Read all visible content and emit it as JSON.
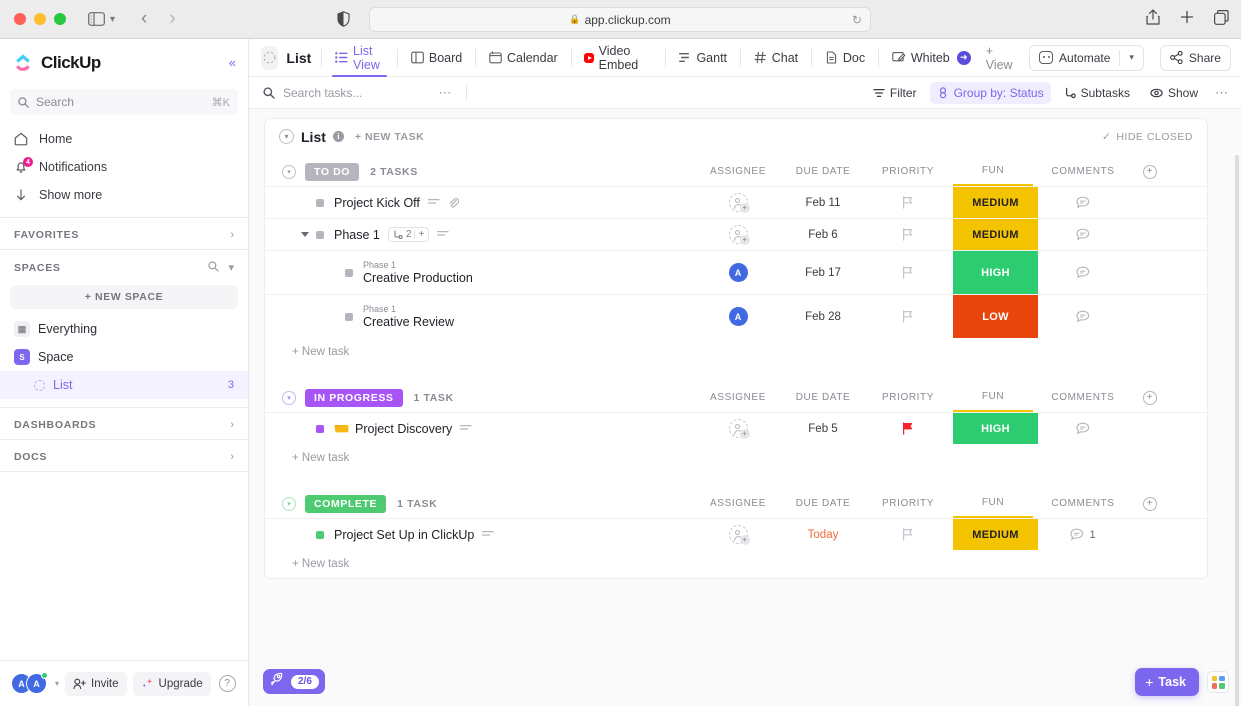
{
  "browser": {
    "url": "app.clickup.com",
    "lock_icon": "lock-icon",
    "reload_icon": "reload-icon",
    "back_icon": "back-arrow-icon",
    "forward_icon": "forward-arrow-icon",
    "sidebar_icon": "sidebar-toggle-icon",
    "share_icon": "share-icon",
    "new_tab_icon": "plus-icon",
    "tabs_icon": "tab-overview-icon"
  },
  "sidebar": {
    "brand": "ClickUp",
    "collapse_icon": "collapse-chevrons-icon",
    "search": {
      "placeholder": "Search",
      "shortcut": "⌘K",
      "icon": "search-icon"
    },
    "nav": [
      {
        "label": "Home",
        "icon": "home-icon",
        "badge": ""
      },
      {
        "label": "Notifications",
        "icon": "bell-icon",
        "badge": "4"
      },
      {
        "label": "Show more",
        "icon": "arrow-down-icon",
        "badge": ""
      }
    ],
    "favorites": {
      "title": "FAVORITES",
      "chevron": "chevron-right-icon"
    },
    "spaces": {
      "title": "SPACES",
      "search_icon": "search-icon",
      "chevron": "chevron-down-icon",
      "new_space": "+ NEW SPACE",
      "items": [
        {
          "label": "Everything",
          "badge": "",
          "icon": "grid-icon",
          "initial": ""
        },
        {
          "label": "Space",
          "badge": "",
          "icon": "space-icon",
          "initial": "S"
        }
      ],
      "child": {
        "label": "List",
        "count": "3",
        "icon": "list-dotted-icon"
      }
    },
    "dashboards": {
      "title": "DASHBOARDS",
      "chevron": "chevron-right-icon"
    },
    "docs": {
      "title": "DOCS",
      "chevron": "chevron-right-icon"
    },
    "footer": {
      "avatars": [
        "A",
        "A"
      ],
      "invite": "Invite",
      "upgrade": "Upgrade",
      "help": "?"
    }
  },
  "viewbar": {
    "list_label": "List",
    "tabs": [
      {
        "label": "List View",
        "icon": "list-view-icon",
        "active": true
      },
      {
        "label": "Board",
        "icon": "board-icon",
        "active": false
      },
      {
        "label": "Calendar",
        "icon": "calendar-icon",
        "active": false
      },
      {
        "label": "Video Embed",
        "icon": "youtube-icon",
        "active": false
      },
      {
        "label": "Gantt",
        "icon": "gantt-icon",
        "active": false
      },
      {
        "label": "Chat",
        "icon": "hash-icon",
        "active": false
      },
      {
        "label": "Doc",
        "icon": "doc-icon",
        "active": false
      },
      {
        "label": "Whiteb",
        "icon": "whiteboard-icon",
        "active": false
      }
    ],
    "add_view": "+ View",
    "automate": "Automate",
    "share": "Share"
  },
  "filterbar": {
    "search_placeholder": "Search tasks...",
    "search_icon": "search-icon",
    "more_icon": "ellipsis-icon",
    "buttons": [
      {
        "label": "Filter",
        "icon": "filter-icon",
        "active": false
      },
      {
        "label": "Group by: Status",
        "icon": "group-icon",
        "active": true
      },
      {
        "label": "Subtasks",
        "icon": "subtasks-icon",
        "active": false
      },
      {
        "label": "Show",
        "icon": "eye-icon",
        "active": false
      }
    ],
    "overflow_icon": "ellipsis-icon"
  },
  "list_header": {
    "name": "List",
    "info_icon": "info-icon",
    "new_task": "+ NEW TASK",
    "hide_closed": "HIDE CLOSED",
    "check_icon": "check-icon"
  },
  "columns": [
    "ASSIGNEE",
    "DUE DATE",
    "PRIORITY",
    "FUN",
    "COMMENTS"
  ],
  "add_column_icon": "plus-circle-icon",
  "colors": {
    "accent": "#7b68ee",
    "todo": "#b5b5bd",
    "in_progress": "#a855f7",
    "complete": "#4ecb71",
    "fun_medium": "#f5c400",
    "fun_high": "#2ecc71",
    "fun_low": "#e8450d",
    "urgent_flag": "#f5222d",
    "today": "#f06a3c"
  },
  "groups": [
    {
      "status": "TO DO",
      "status_color": "#b5b5bd",
      "count": "2 TASKS",
      "add_row": "+ New task",
      "tasks": [
        {
          "name": "Project Kick Off",
          "parent": "",
          "dot_color": "#b5b5bd",
          "icons": [
            "description-icon",
            "attachment-icon"
          ],
          "indent": 0,
          "assignee": "",
          "due_date": "Feb 11",
          "due_today": false,
          "priority_flag": "none",
          "fun": "MEDIUM",
          "fun_color": "#f5c400",
          "fun_text_color": "#232323",
          "comments": ""
        },
        {
          "name": "Phase 1",
          "parent": "",
          "dot_color": "#b5b5bd",
          "icons": [
            "description-icon"
          ],
          "subtask_count": "2",
          "expanded": true,
          "indent": 0,
          "assignee": "",
          "due_date": "Feb 6",
          "due_today": false,
          "priority_flag": "none",
          "fun": "MEDIUM",
          "fun_color": "#f5c400",
          "fun_text_color": "#232323",
          "comments": ""
        },
        {
          "name": "Creative Production",
          "parent": "Phase 1",
          "dot_color": "#b5b5bd",
          "icons": [],
          "indent": 1,
          "assignee": "A",
          "due_date": "Feb 17",
          "due_today": false,
          "priority_flag": "none",
          "fun": "HIGH",
          "fun_color": "#2ecc71",
          "fun_text_color": "#ffffff",
          "comments": ""
        },
        {
          "name": "Creative Review",
          "parent": "Phase 1",
          "dot_color": "#b5b5bd",
          "icons": [],
          "indent": 1,
          "assignee": "A",
          "due_date": "Feb 28",
          "due_today": false,
          "priority_flag": "none",
          "fun": "LOW",
          "fun_color": "#e8450d",
          "fun_text_color": "#ffffff",
          "comments": ""
        }
      ]
    },
    {
      "status": "IN PROGRESS",
      "status_color": "#a855f7",
      "count": "1 TASK",
      "add_row": "+ New task",
      "tasks": [
        {
          "name": "Project Discovery",
          "parent": "",
          "dot_color": "#a855f7",
          "tag_icon": "yellow-tag-icon",
          "icons": [
            "description-icon"
          ],
          "indent": 0,
          "assignee": "",
          "due_date": "Feb 5",
          "due_today": false,
          "priority_flag": "urgent",
          "fun": "HIGH",
          "fun_color": "#2ecc71",
          "fun_text_color": "#ffffff",
          "comments": ""
        }
      ]
    },
    {
      "status": "COMPLETE",
      "status_color": "#4ecb71",
      "count": "1 TASK",
      "add_row": "+ New task",
      "tasks": [
        {
          "name": "Project Set Up in ClickUp",
          "parent": "",
          "dot_color": "#4ecb71",
          "icons": [
            "description-icon"
          ],
          "indent": 0,
          "assignee": "",
          "due_date": "Today",
          "due_today": true,
          "priority_flag": "none",
          "fun": "MEDIUM",
          "fun_color": "#f5c400",
          "fun_text_color": "#232323",
          "comments": "1"
        }
      ]
    }
  ],
  "bottom": {
    "rocket_label": "2/6",
    "rocket_icon": "rocket-icon",
    "task_button": "Task",
    "apps_icon": "apps-grid-icon"
  }
}
